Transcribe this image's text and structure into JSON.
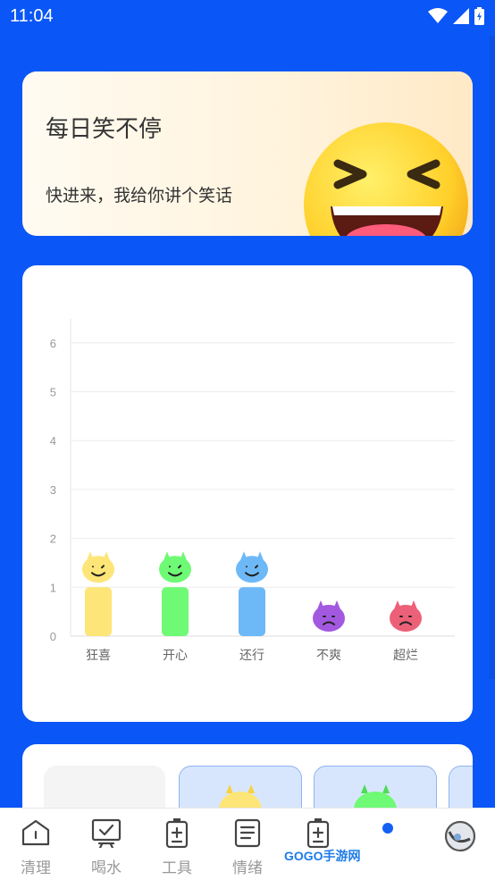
{
  "status_bar": {
    "time": "11:04"
  },
  "banner": {
    "title": "每日笑不停",
    "subtitle": "快进来，我给你讲个笑话"
  },
  "chart_data": {
    "type": "bar",
    "categories": [
      "狂喜",
      "开心",
      "还行",
      "不爽",
      "超烂"
    ],
    "values": [
      1,
      1,
      1,
      0,
      0
    ],
    "ylim": [
      0,
      6.5
    ],
    "yticks": [
      "0",
      "1",
      "2",
      "3",
      "4",
      "5",
      "6"
    ],
    "grid": true,
    "colors": [
      "#fde577",
      "#6efa74",
      "#6db9f7",
      "#a259e0",
      "#ec6178"
    ]
  },
  "tabs": [
    {
      "label": "清理",
      "icon": "home-icon"
    },
    {
      "label": "喝水",
      "icon": "monitor-check-icon"
    },
    {
      "label": "工具",
      "icon": "battery-plus-icon"
    },
    {
      "label": "情绪",
      "icon": "document-icon"
    },
    {
      "label": "",
      "icon": "battery-plus-icon"
    },
    {
      "label": "",
      "icon": "avatar-icon"
    }
  ],
  "watermark": "GOGO手游网"
}
